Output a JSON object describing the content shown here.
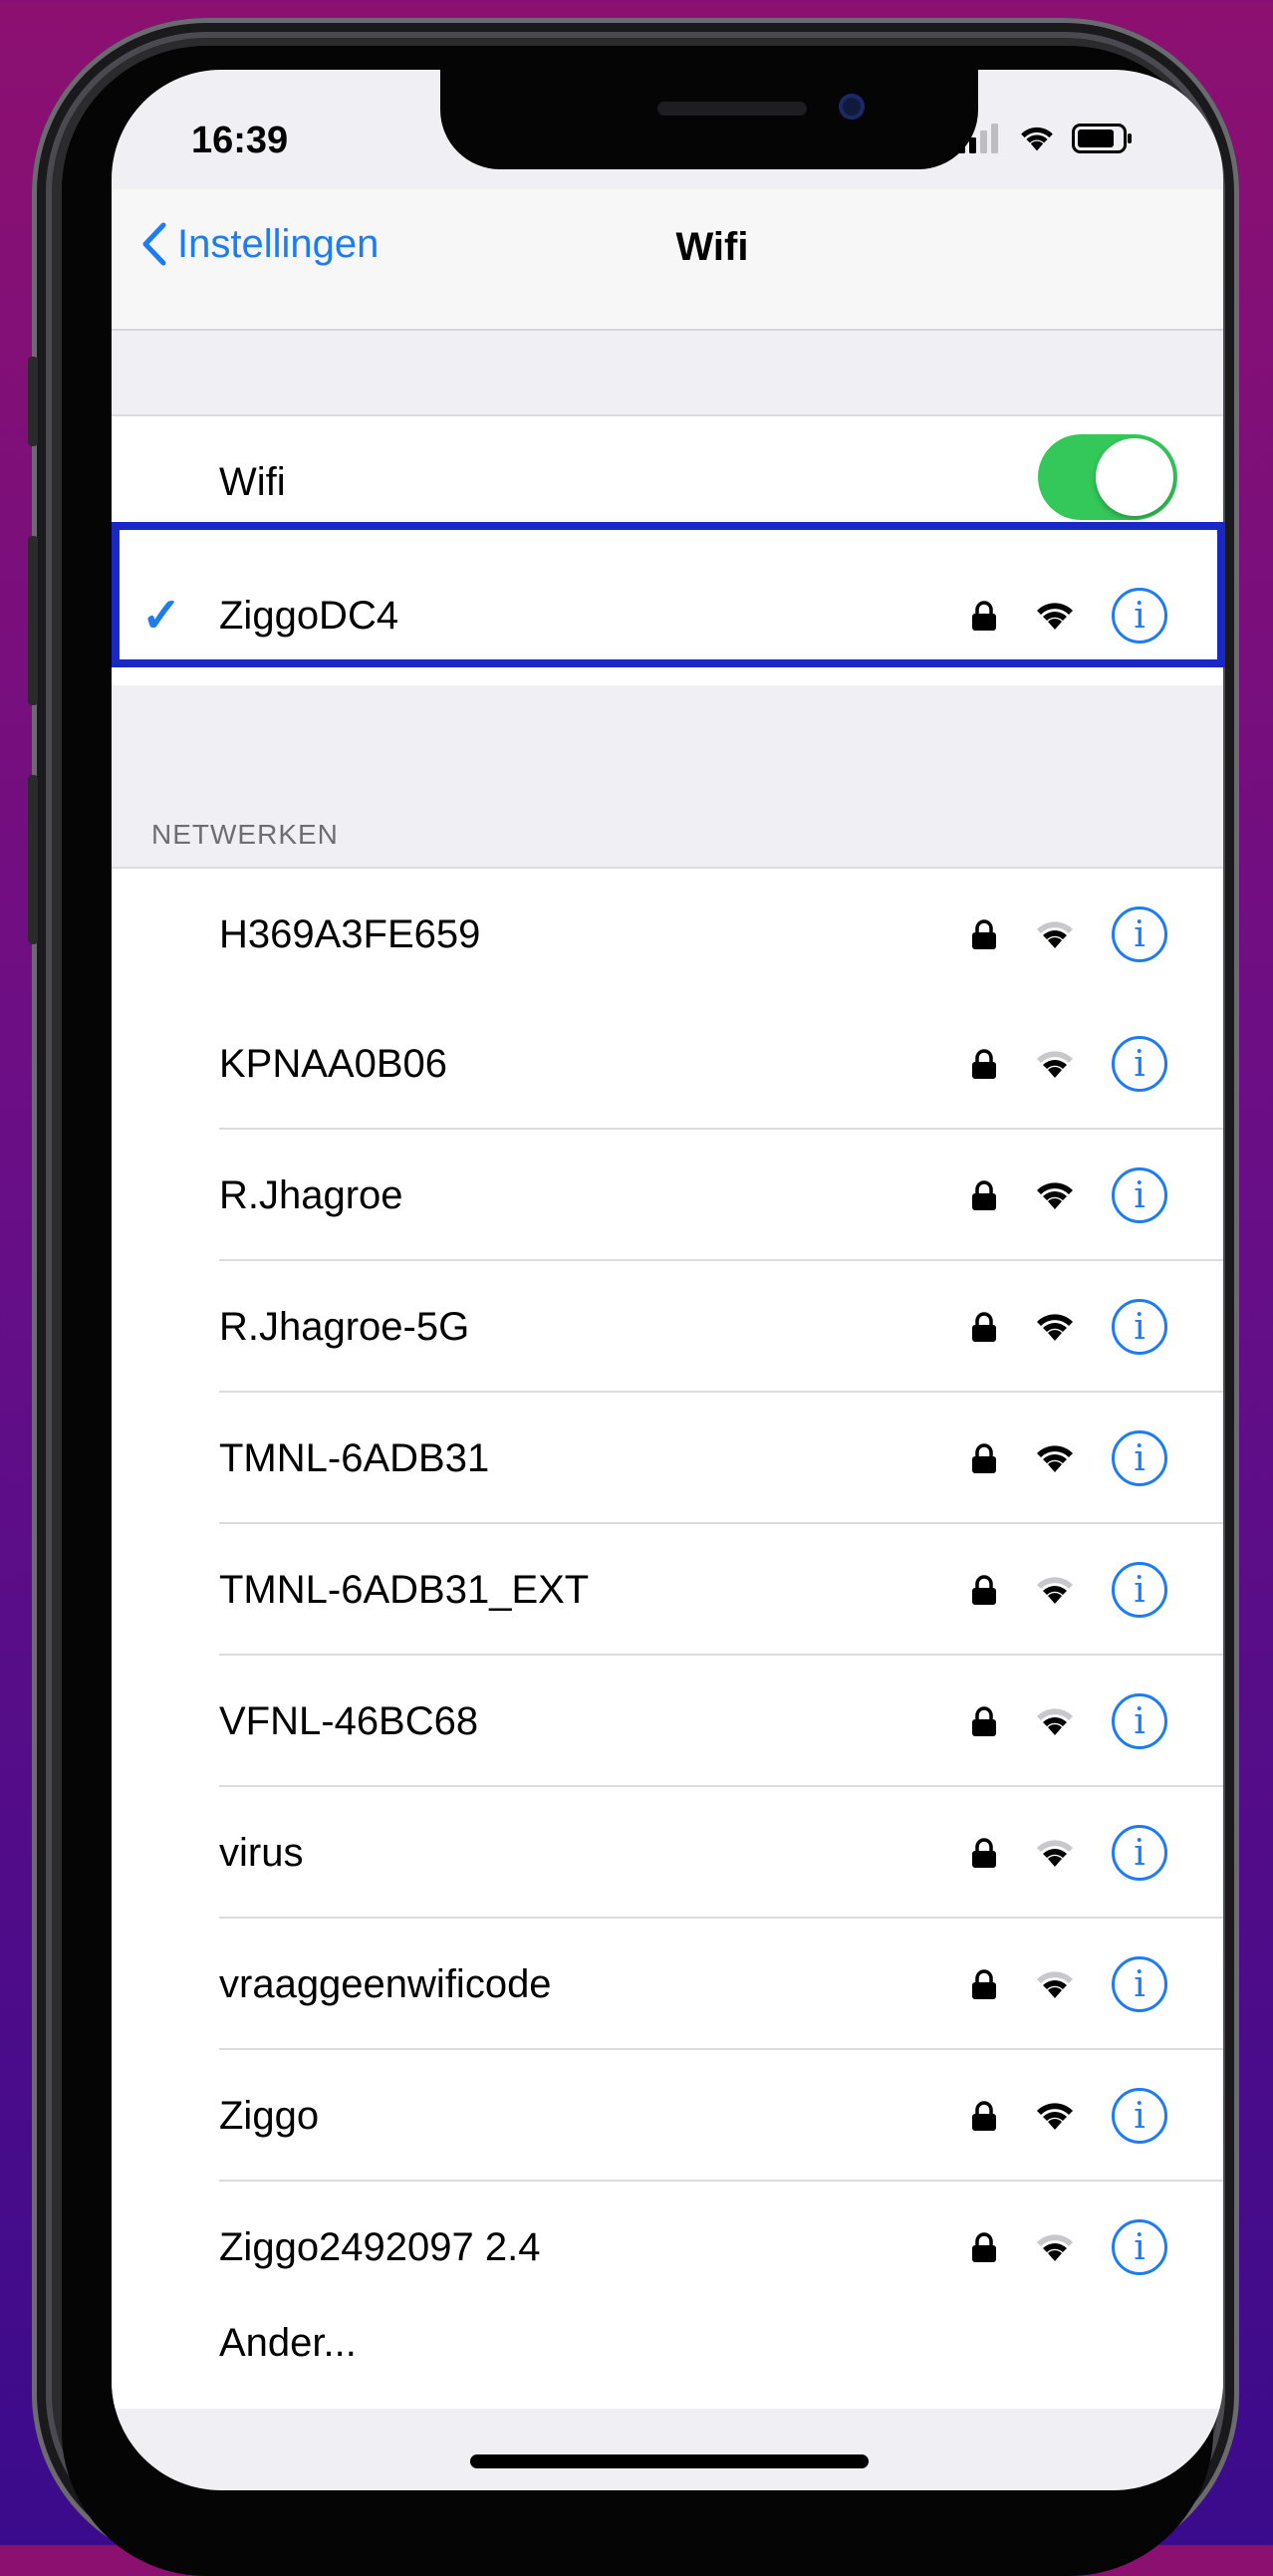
{
  "status_bar": {
    "time": "16:39",
    "icons": [
      "cellular-signal-icon",
      "wifi-icon",
      "battery-icon"
    ]
  },
  "nav": {
    "back_label": "Instellingen",
    "title": "Wifi"
  },
  "wifi_toggle": {
    "label": "Wifi",
    "on": true
  },
  "connected": {
    "name": "ZiggoDC4",
    "secured": true,
    "signal": "strong"
  },
  "networks_header": "NETWERKEN",
  "networks": [
    {
      "name": "H369A3FE659",
      "secured": true,
      "signal": "weak"
    },
    {
      "name": "KPNAA0B06",
      "secured": true,
      "signal": "weak"
    },
    {
      "name": "R.Jhagroe",
      "secured": true,
      "signal": "strong"
    },
    {
      "name": "R.Jhagroe-5G",
      "secured": true,
      "signal": "strong"
    },
    {
      "name": "TMNL-6ADB31",
      "secured": true,
      "signal": "strong"
    },
    {
      "name": "TMNL-6ADB31_EXT",
      "secured": true,
      "signal": "weak"
    },
    {
      "name": "VFNL-46BC68",
      "secured": true,
      "signal": "weak"
    },
    {
      "name": "virus",
      "secured": true,
      "signal": "weak"
    },
    {
      "name": "vraaggeenwificode",
      "secured": true,
      "signal": "weak"
    },
    {
      "name": "Ziggo",
      "secured": true,
      "signal": "strong"
    },
    {
      "name": "Ziggo2492097 2.4",
      "secured": true,
      "signal": "weak"
    }
  ],
  "other_label": "Ander...",
  "info_glyph": "i",
  "colors": {
    "accent": "#1e7cf2",
    "toggle_on": "#34c759",
    "highlight": "#1a27c7"
  }
}
